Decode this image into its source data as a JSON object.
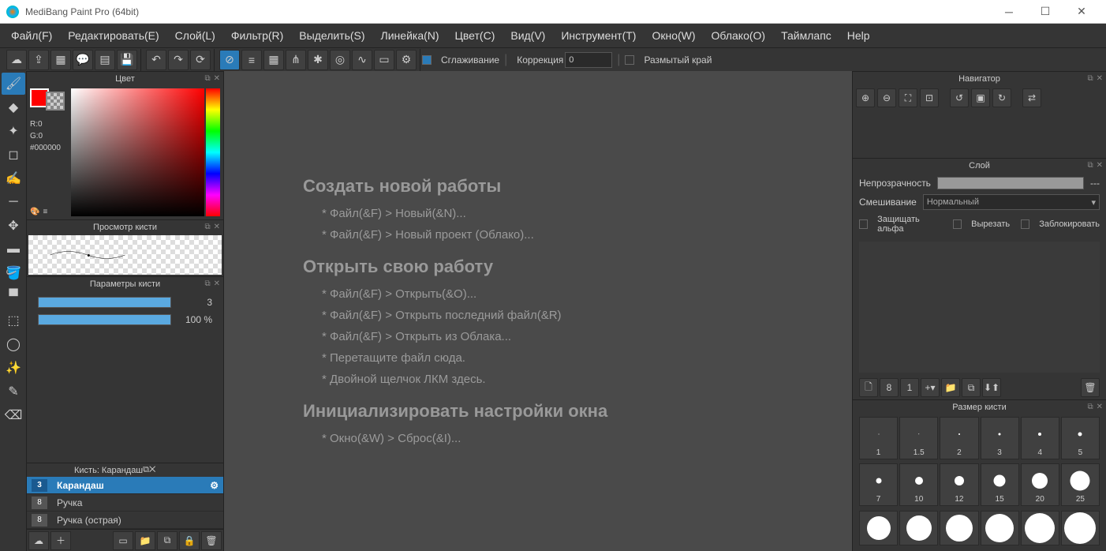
{
  "title": "MediBang Paint Pro (64bit)",
  "menus": [
    "Файл(F)",
    "Редактировать(E)",
    "Слой(L)",
    "Фильтр(R)",
    "Выделить(S)",
    "Линейка(N)",
    "Цвет(C)",
    "Вид(V)",
    "Инструмент(T)",
    "Окно(W)",
    "Облако(O)",
    "Таймлапс",
    "Help"
  ],
  "toolbar": {
    "smoothing_cb": "Сглаживание",
    "correction": "Коррекция",
    "correction_val": "0",
    "blurred_edge": "Размытый край"
  },
  "color": {
    "title": "Цвет",
    "r": "R:0",
    "g": "G:0",
    "hex": "#000000"
  },
  "brushpreview": {
    "title": "Просмотр кисти"
  },
  "brushparams": {
    "title": "Параметры кисти",
    "size_val": "3",
    "opacity_val": "100 %"
  },
  "brushlist": {
    "title": "Кисть: Карандаш",
    "items": [
      {
        "size": "3",
        "name": "Карандаш",
        "sel": true
      },
      {
        "size": "8",
        "name": "Ручка",
        "sel": false
      },
      {
        "size": "8",
        "name": "Ручка (острая)",
        "sel": false
      }
    ]
  },
  "welcome": {
    "h1": "Создать новой работы",
    "l1": "* Файл(&F) > Новый(&N)...",
    "l2": "* Файл(&F) > Новый проект (Облако)...",
    "h2": "Открыть свою работу",
    "l3": "* Файл(&F) > Открыть(&O)...",
    "l4": "* Файл(&F) > Открыть последний файл(&R)",
    "l5": "* Файл(&F) > Открыть из Облака...",
    "l6": "* Перетащите файл сюда.",
    "l7": "* Двойной щелчок ЛКМ здесь.",
    "h3": "Инициализировать настройки окна",
    "l8": "* Окно(&W) > Сброс(&I)..."
  },
  "nav": {
    "title": "Навигатор"
  },
  "layer": {
    "title": "Слой",
    "opacity": "Непрозрачность",
    "opacity_dash": "---",
    "blend": "Смешивание",
    "blend_val": "Нормальный",
    "protect": "Защищать альфа",
    "cut": "Вырезать",
    "lock": "Заблокировать"
  },
  "brushsize": {
    "title": "Размер кисти",
    "row1": [
      "1",
      "1.5",
      "2",
      "3",
      "4",
      "5"
    ],
    "row2": [
      "7",
      "10",
      "12",
      "15",
      "20",
      "25"
    ]
  }
}
